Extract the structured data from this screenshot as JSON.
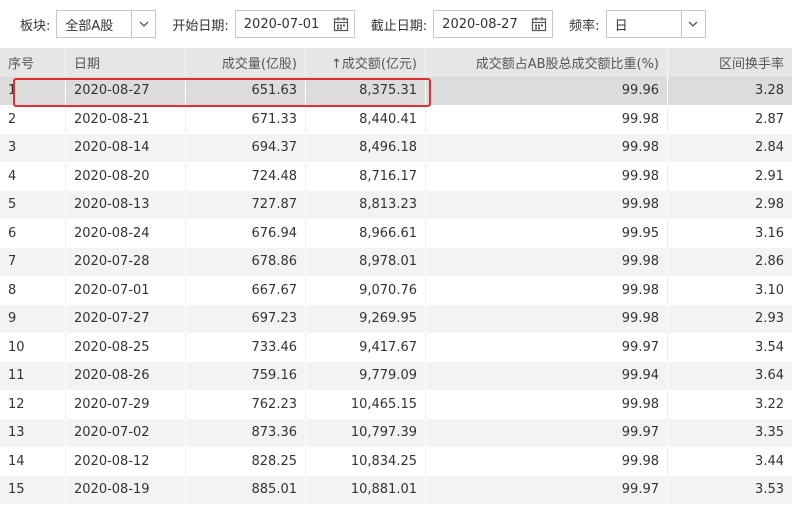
{
  "toolbar": {
    "sector_label": "板块:",
    "sector_value": "全部A股",
    "start_label": "开始日期:",
    "start_value": "2020-07-01",
    "end_label": "截止日期:",
    "end_value": "2020-08-27",
    "freq_label": "频率:",
    "freq_value": "日"
  },
  "table": {
    "headers": [
      "序号",
      "日期",
      "成交量(亿股)",
      "↑成交额(亿元)",
      "成交额占AB股总成交额比重(%)",
      "区间换手率"
    ],
    "rows": [
      [
        "1",
        "2020-08-27",
        "651.63",
        "8,375.31",
        "99.96",
        "3.28"
      ],
      [
        "2",
        "2020-08-21",
        "671.33",
        "8,440.41",
        "99.98",
        "2.87"
      ],
      [
        "3",
        "2020-08-14",
        "694.37",
        "8,496.18",
        "99.98",
        "2.84"
      ],
      [
        "4",
        "2020-08-20",
        "724.48",
        "8,716.17",
        "99.98",
        "2.91"
      ],
      [
        "5",
        "2020-08-13",
        "727.87",
        "8,813.23",
        "99.98",
        "2.98"
      ],
      [
        "6",
        "2020-08-24",
        "676.94",
        "8,966.61",
        "99.95",
        "3.16"
      ],
      [
        "7",
        "2020-07-28",
        "678.86",
        "8,978.01",
        "99.98",
        "2.86"
      ],
      [
        "8",
        "2020-07-01",
        "667.67",
        "9,070.76",
        "99.98",
        "3.10"
      ],
      [
        "9",
        "2020-07-27",
        "697.23",
        "9,269.95",
        "99.98",
        "2.93"
      ],
      [
        "10",
        "2020-08-25",
        "733.46",
        "9,417.67",
        "99.97",
        "3.54"
      ],
      [
        "11",
        "2020-08-26",
        "759.16",
        "9,779.09",
        "99.94",
        "3.64"
      ],
      [
        "12",
        "2020-07-29",
        "762.23",
        "10,465.15",
        "99.98",
        "3.22"
      ],
      [
        "13",
        "2020-07-02",
        "873.36",
        "10,797.39",
        "99.97",
        "3.35"
      ],
      [
        "14",
        "2020-08-12",
        "828.25",
        "10,834.25",
        "99.98",
        "3.44"
      ],
      [
        "15",
        "2020-08-19",
        "885.01",
        "10,881.01",
        "99.97",
        "3.53"
      ]
    ]
  },
  "colors": {
    "highlight": "#e0302c",
    "header_bg": "#e6e6e6",
    "row_alt_bg": "#f3f3f3",
    "selected_bg": "#dcdcdc"
  },
  "icons": {
    "dropdown": "chevron-down-icon",
    "date_picker": "calendar-icon"
  }
}
